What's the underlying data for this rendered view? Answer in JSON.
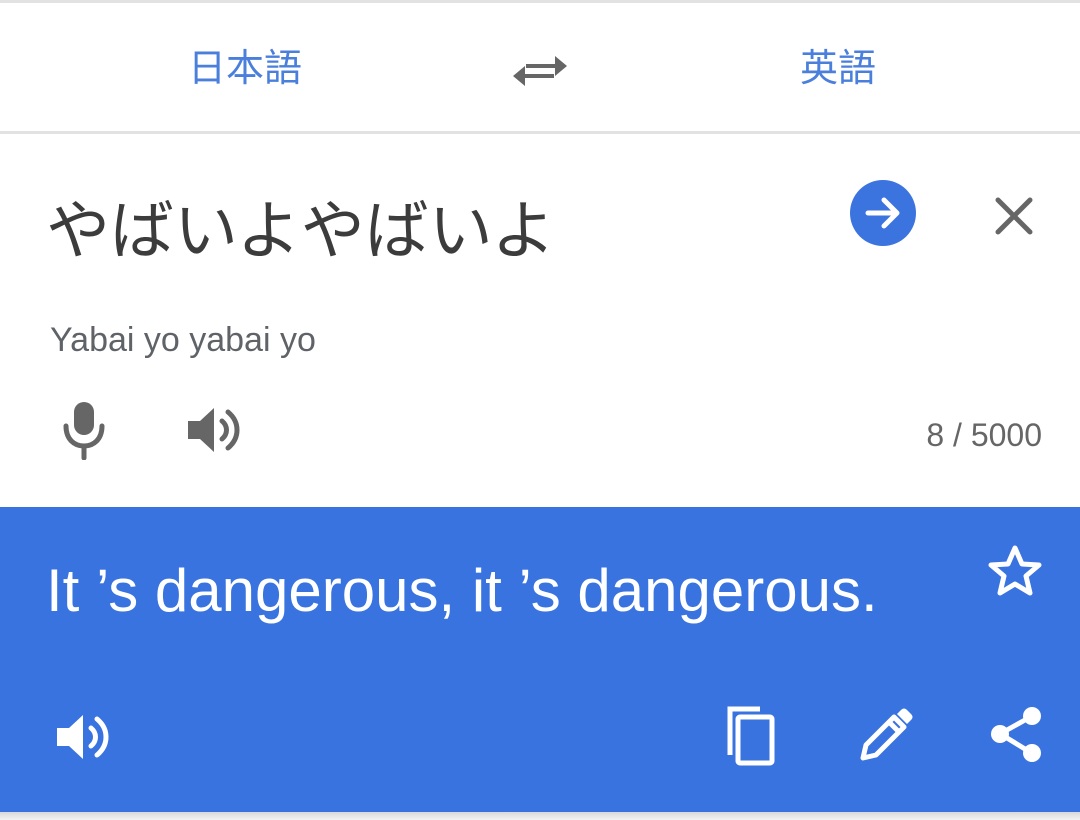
{
  "languages": {
    "source": "日本語",
    "target": "英語"
  },
  "input": {
    "text": "やばいよやばいよ",
    "transliteration": "Yabai yo yabai yo",
    "counter": "8 / 5000"
  },
  "output": {
    "translation": "It ’s dangerous, it ’s dangerous."
  },
  "icons": {
    "swap": "swap-horiz-icon",
    "go": "arrow-forward-icon",
    "close": "close-icon",
    "mic": "microphone-icon",
    "speaker": "volume-up-icon",
    "star": "star-outline-icon",
    "copy": "copy-icon",
    "edit": "edit-pencil-icon",
    "share": "share-icon"
  },
  "colors": {
    "accent": "#3873df",
    "language_text": "#4a7fdc",
    "icon_gray": "#666666",
    "white": "#ffffff"
  }
}
